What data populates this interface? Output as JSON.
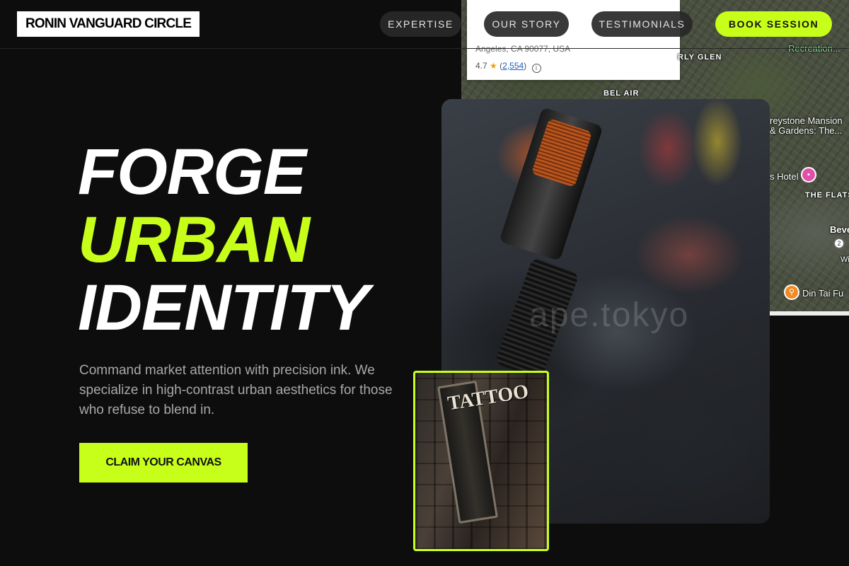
{
  "header": {
    "logo": "RONIN VANGUARD CIRCLE",
    "nav": [
      {
        "label": "EXPERTISE"
      },
      {
        "label": "OUR STORY"
      },
      {
        "label": "TESTIMONIALS"
      }
    ],
    "book_label": "BOOK SESSION"
  },
  "hero": {
    "line1": "FORGE",
    "line2": "URBAN",
    "line3": "IDENTITY",
    "description": "Command market attention with precision ink. We specialize in high-contrast urban aesthetics for those who refuse to blend in.",
    "cta_label": "CLAIM YOUR CANVAS"
  },
  "map": {
    "address": "Angeles, CA 90077, USA",
    "rating": "4.7",
    "review_count": "2,554",
    "labels": {
      "recreation": "Recreation...",
      "beverly_glen": "RLY GLEN",
      "bel_air": "BEL AIR",
      "greystone": "reystone Mansion\n& Gardens: The...",
      "hotel": "s Hotel",
      "the_flats": "THE FLATS",
      "beve": "Beve",
      "wils": "Wils",
      "din_tai": "Din Tai Fu"
    }
  },
  "photos": {
    "watermark": "ape.tokyo",
    "sign_text": "TATTOO"
  },
  "colors": {
    "accent": "#c8ff1a",
    "background": "#0d0d0d"
  }
}
